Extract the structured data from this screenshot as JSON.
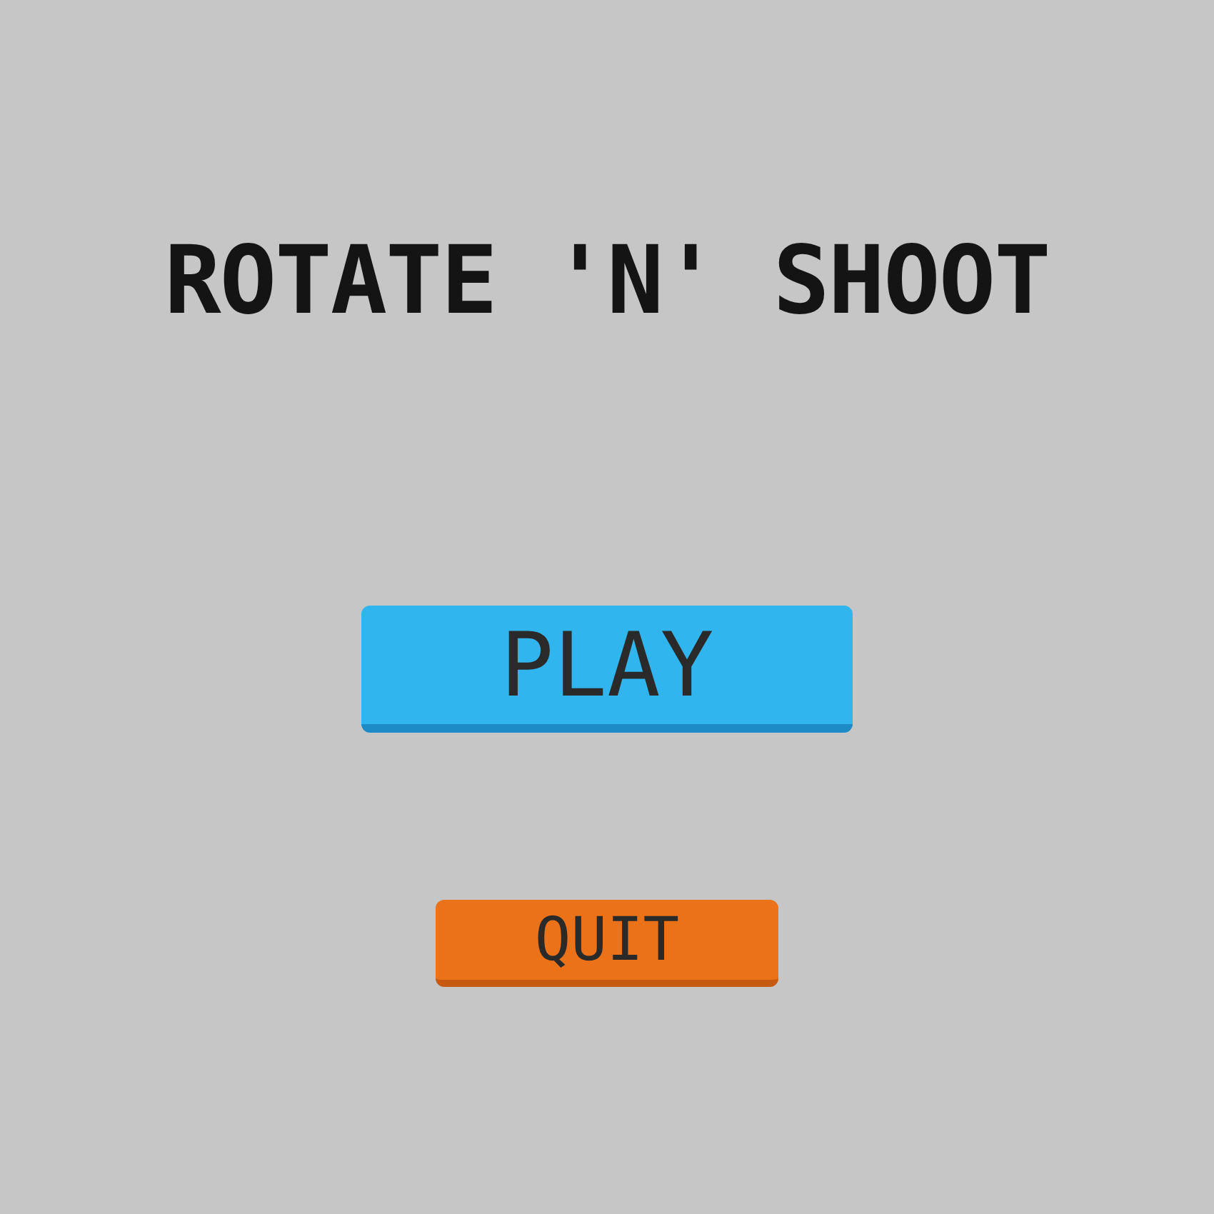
{
  "title": "ROTATE 'N' SHOOT",
  "buttons": [
    {
      "label": "PLAY",
      "kind": "primary"
    },
    {
      "label": "QUIT",
      "kind": "secondary"
    }
  ]
}
